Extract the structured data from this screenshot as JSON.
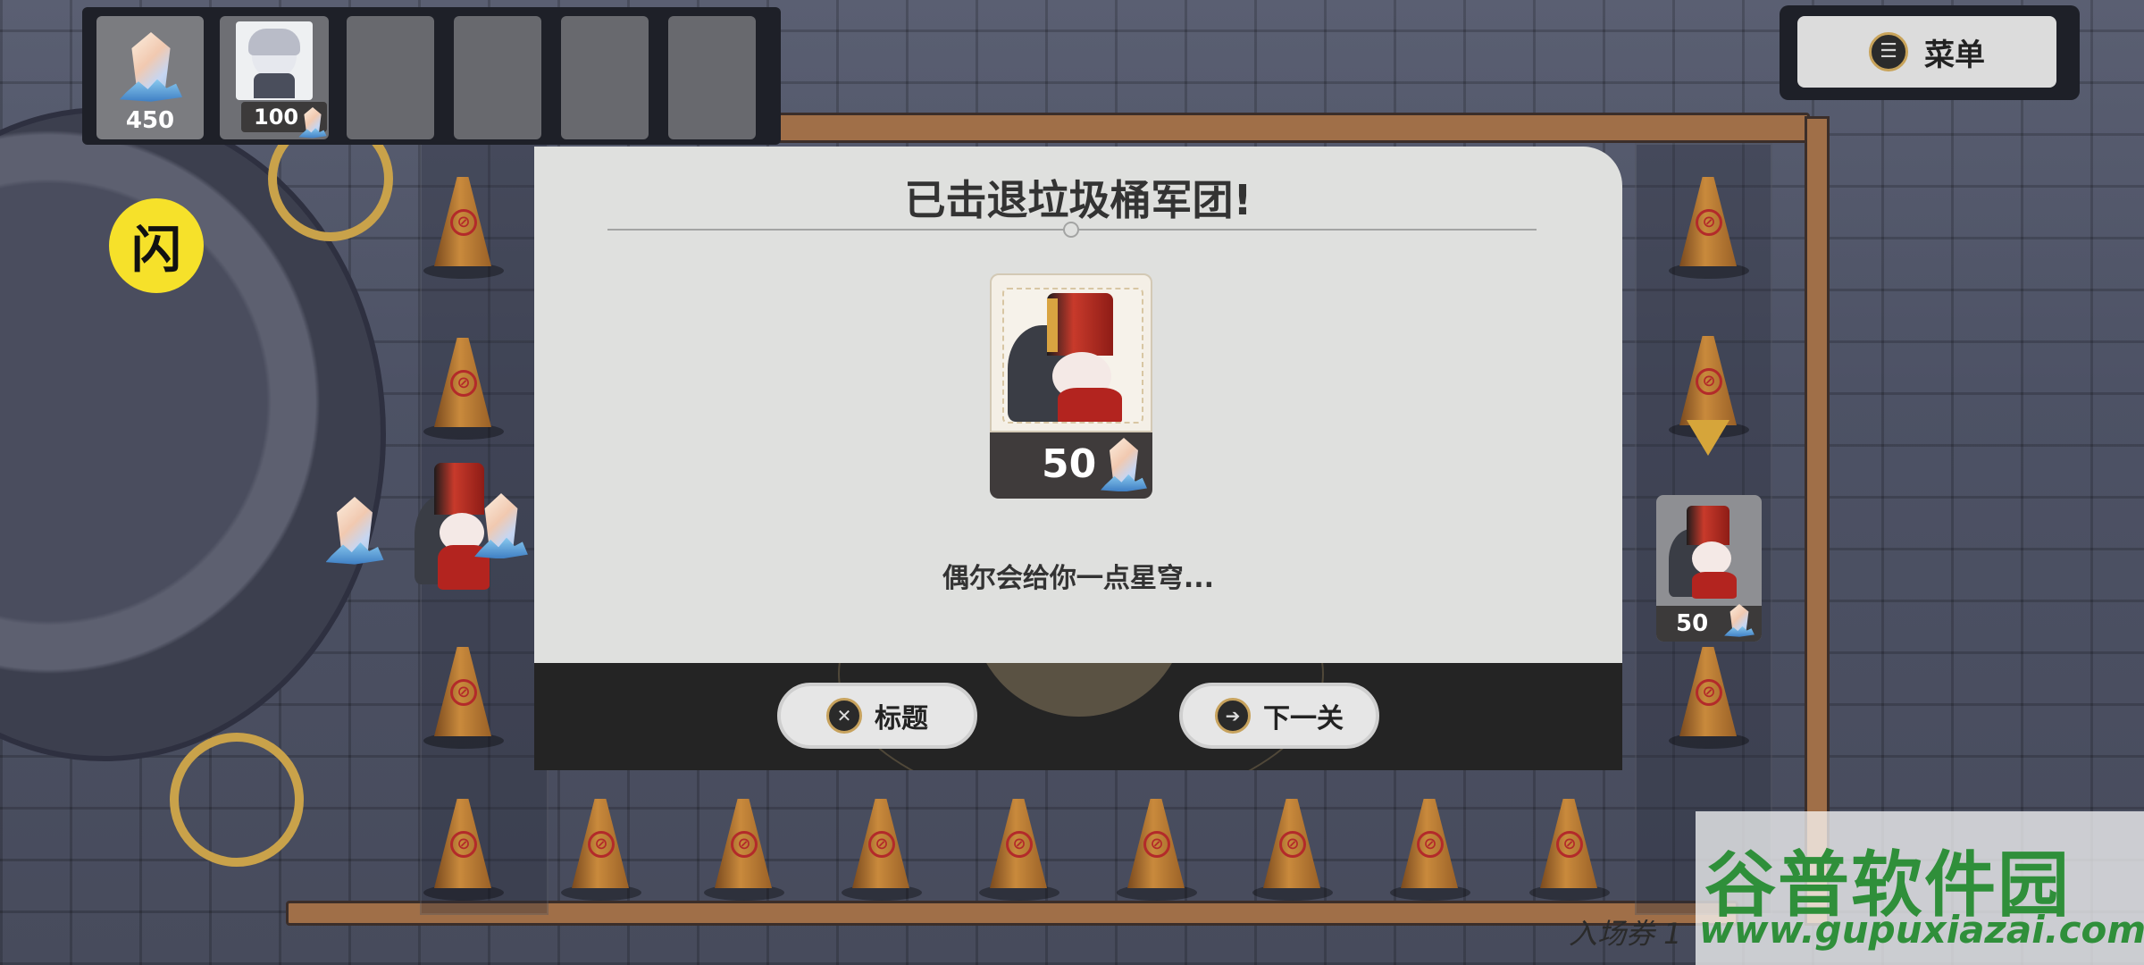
{
  "hud": {
    "currency_amount": "450",
    "unit_cost": "100"
  },
  "menu": {
    "icon_glyph": "☰",
    "label": "菜单"
  },
  "flash": {
    "glyph": "闪"
  },
  "dialog": {
    "title": "已击退垃圾桶军团!",
    "reward_cost": "50",
    "description": "偶尔会给你一点星穹...",
    "buttons": {
      "title_label": "标题",
      "title_icon": "✕",
      "next_label": "下一关",
      "next_icon": "➔"
    }
  },
  "queue": {
    "cost": "50"
  },
  "footer": {
    "ticket": "入场券 1"
  },
  "watermark": {
    "name": "谷普软件园",
    "url": "www.gupuxiazai.com"
  },
  "colors": {
    "accent_yellow": "#f6e12a",
    "cone_orange": "#c98a3c",
    "watermark_green": "#2f8f3a"
  },
  "icons": [
    "crystal-icon",
    "menu-icon",
    "flash-icon",
    "close-icon",
    "next-arrow-icon",
    "traffic-cone-icon"
  ]
}
